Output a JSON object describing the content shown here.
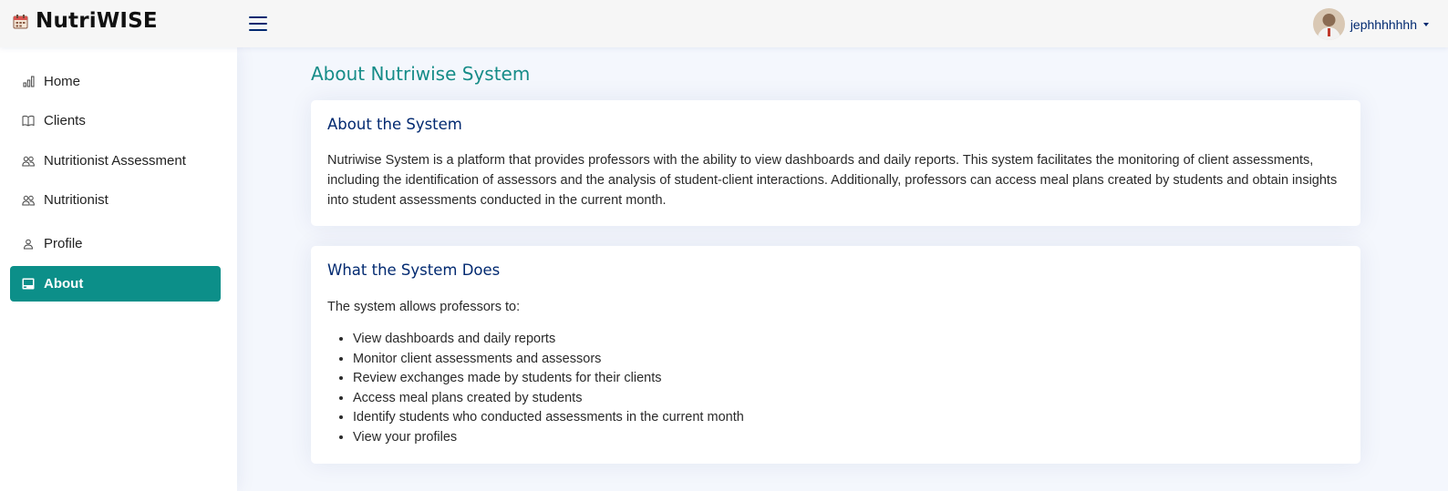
{
  "app": {
    "brand": "NutriWISE",
    "logo_icon": "calendar-icon",
    "menu_icon": "hamburger-menu-icon",
    "accent_color": "#0c8f89",
    "title_color": "#168c88",
    "heading_color": "#012970"
  },
  "user": {
    "name": "jephhhhhhh",
    "avatar_icon": "user-avatar"
  },
  "sidebar": {
    "items": [
      {
        "label": "Home",
        "icon": "bar-chart-icon",
        "active": false
      },
      {
        "label": "Clients",
        "icon": "book-icon",
        "active": false
      },
      {
        "label": "Nutritionist Assessment",
        "icon": "people-icon",
        "active": false
      },
      {
        "label": "Nutritionist",
        "icon": "people-icon",
        "active": false
      },
      {
        "label": "Profile",
        "icon": "person-icon",
        "active": false
      },
      {
        "label": "About",
        "icon": "window-icon",
        "active": true
      }
    ]
  },
  "main": {
    "page_title": "About Nutriwise System",
    "about_card": {
      "title": "About the System",
      "text": "Nutriwise System is a platform that provides professors with the ability to view dashboards and daily reports. This system facilitates the monitoring of client assessments, including the identification of assessors and the analysis of student-client interactions. Additionally, professors can access meal plans created by students and obtain insights into student assessments conducted in the current month."
    },
    "does_card": {
      "title": "What the System Does",
      "intro": "The system allows professors to:",
      "items": [
        "View dashboards and daily reports",
        "Monitor client assessments and assessors",
        "Review exchanges made by students for their clients",
        "Access meal plans created by students",
        "Identify students who conducted assessments in the current month",
        "View your profiles"
      ]
    }
  }
}
